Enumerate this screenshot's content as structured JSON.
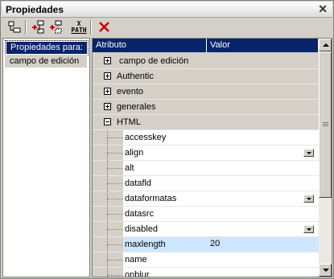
{
  "window": {
    "title": "Propiedades"
  },
  "toolbar": {
    "icons": [
      "show-all-icon",
      "add-child-icon",
      "add-sibling-icon",
      "xpath-icon",
      "delete-icon"
    ],
    "xpath_label_top": "X",
    "xpath_label_bottom": "PATH"
  },
  "left": {
    "header": "Propiedades para:",
    "items": [
      "campo de edición"
    ]
  },
  "grid": {
    "col_attr": "Atributo",
    "col_val": "Valor",
    "groups": [
      {
        "label": "campo de edición",
        "expanded": false
      },
      {
        "label": "Authentic",
        "expanded": false
      },
      {
        "label": "evento",
        "expanded": false
      },
      {
        "label": "generales",
        "expanded": false
      },
      {
        "label": "HTML",
        "expanded": true
      }
    ],
    "rows": [
      {
        "attr": "accesskey",
        "value": ""
      },
      {
        "attr": "align",
        "value": ""
      },
      {
        "attr": "alt",
        "value": ""
      },
      {
        "attr": "datafld",
        "value": ""
      },
      {
        "attr": "dataformatas",
        "value": ""
      },
      {
        "attr": "datasrc",
        "value": ""
      },
      {
        "attr": "disabled",
        "value": ""
      },
      {
        "attr": "maxlength",
        "value": "20"
      },
      {
        "attr": "name",
        "value": ""
      },
      {
        "attr": "onblur",
        "value": ""
      }
    ]
  },
  "colors": {
    "header_bg": "#0a246a",
    "selected_bg": "#cde6ff",
    "delete_red": "#cc0000"
  }
}
